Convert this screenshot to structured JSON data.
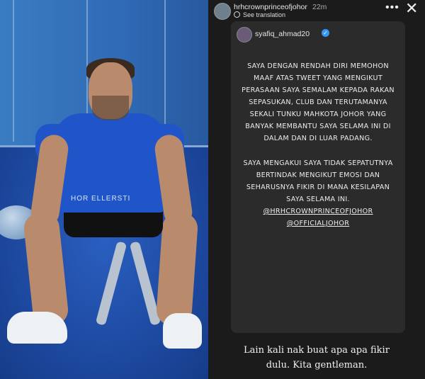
{
  "story": {
    "owner_username": "hrhcrownprince​ofjohor",
    "time_ago": "22m",
    "see_translation": "See translation",
    "more_label": "•••",
    "close_label": "✕",
    "shared_post": {
      "username": "syafiq_ahmad20",
      "verified_label": "✓",
      "paragraph1": "SAYA DENGAN RENDAH DIRI MEMOHON MAAF ATAS TWEET YANG MENGIKUT PERASAAN SAYA SEMALAM KEPADA RAKAN SEPASUKAN, CLUB DAN TERUTAMANYA SEKALI TUNKU MAHKOTA JOHOR YANG BANYAK MEMBANTU SAYA SELAMA INI DI DALAM DAN DI LUAR PADANG.",
      "paragraph2": "SAYA MENGAKUI SAYA TIDAK SEPATUTNYA BERTINDAK MENGIKUT EMOSI DAN SEHARUSNYA FIKIR DI MANA KESILAPAN SAYA SELAMA INI.",
      "mention1": "@HRHCROWNPRINCEOFJOHOR",
      "mention2": "@OFFICIALJOHOR"
    },
    "caption_line1": "Lain kali nak buat apa apa fikir",
    "caption_line2": "dulu. Kita gentleman."
  },
  "photo": {
    "jersey_text": "HOR ELLERSTI",
    "colors": {
      "jersey": "#1f55c9",
      "background": "#2b66b0"
    }
  }
}
